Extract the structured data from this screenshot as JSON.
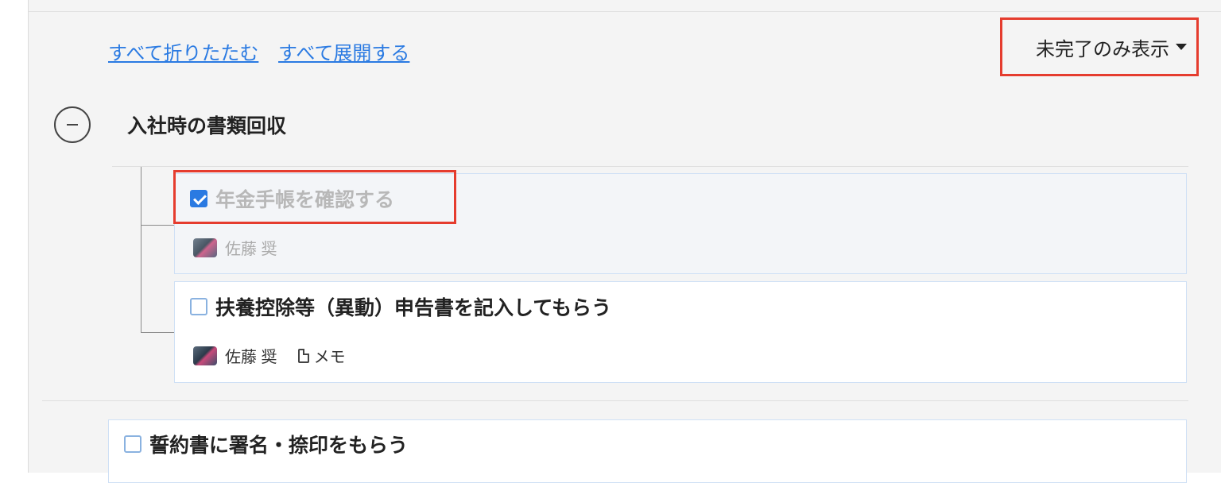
{
  "controls": {
    "collapse_all": "すべて折りたたむ",
    "expand_all": "すべて展開する",
    "filter_label": "未完了のみ表示"
  },
  "group": {
    "title": "入社時の書類回収"
  },
  "tasks": [
    {
      "title": "年金手帳を確認する",
      "assignee": "佐藤 奨",
      "checked": true
    },
    {
      "title": "扶養控除等（異動）申告書を記入してもらう",
      "assignee": "佐藤 奨",
      "memo": "メモ",
      "checked": false
    },
    {
      "title": "誓約書に署名・捺印をもらう",
      "checked": false
    }
  ],
  "icons": {
    "toggle": "minus-circle-icon",
    "caret": "caret-down-icon",
    "memo": "memo-icon",
    "avatar": "avatar"
  },
  "colors": {
    "link": "#2a7ae2",
    "highlight": "#e53c2e",
    "checkbox": "#2a7ae2"
  }
}
